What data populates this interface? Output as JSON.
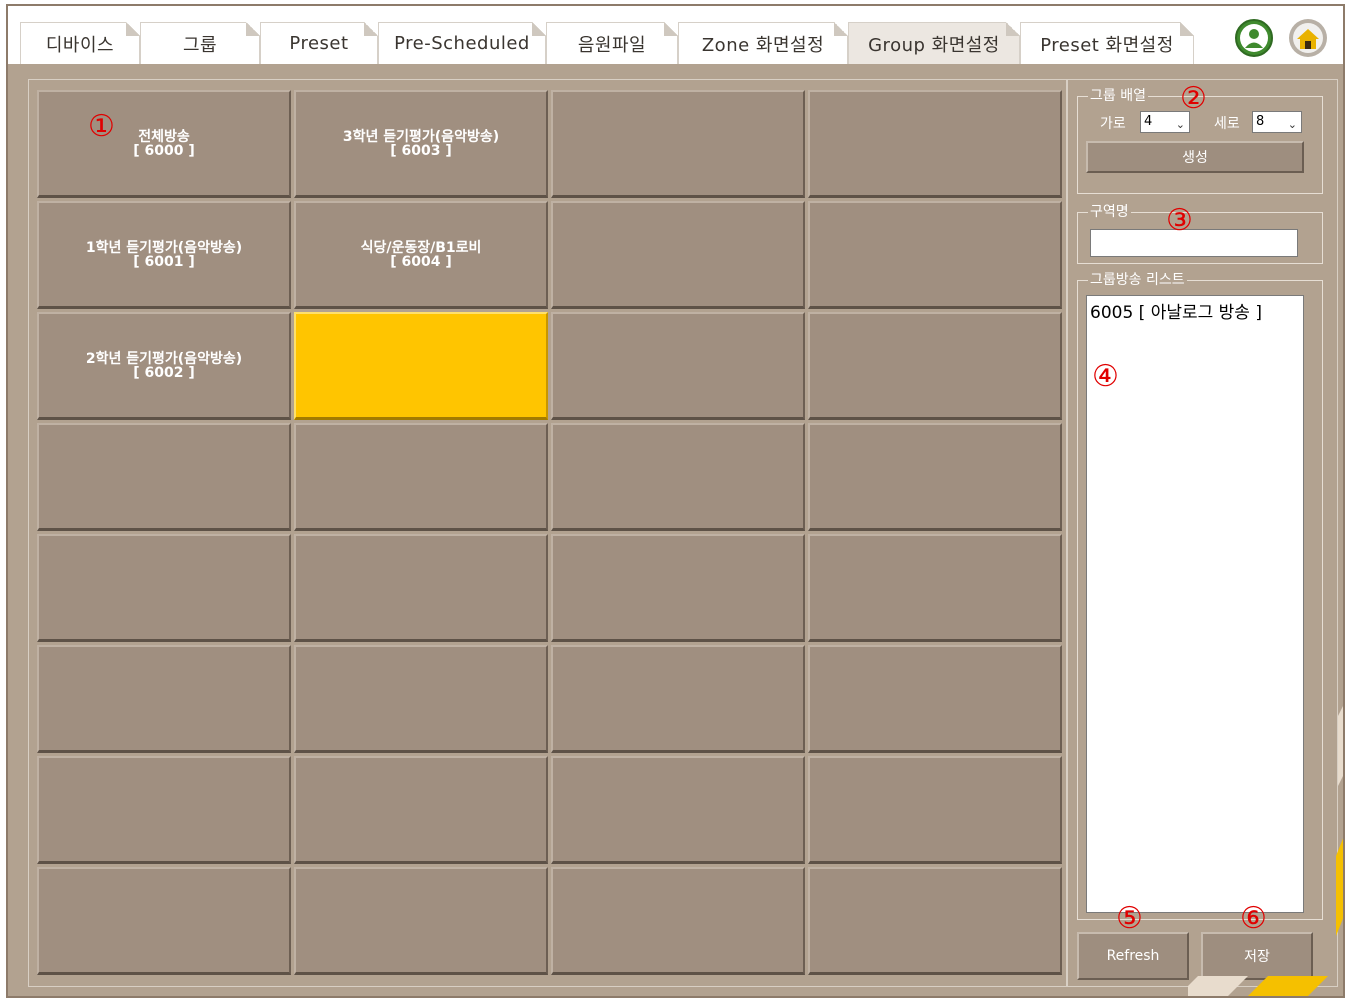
{
  "tabs": [
    {
      "label": "디바이스",
      "active": false
    },
    {
      "label": "그룹",
      "active": false
    },
    {
      "label": "Preset",
      "active": false
    },
    {
      "label": "Pre-Scheduled",
      "active": false
    },
    {
      "label": "음원파일",
      "active": false
    },
    {
      "label": "Zone 화면설정",
      "active": false
    },
    {
      "label": "Group 화면설정",
      "active": true
    },
    {
      "label": "Preset 화면설정",
      "active": false
    }
  ],
  "top_icons": [
    {
      "icon": "user-icon",
      "color": "#3f8a2e"
    },
    {
      "icon": "home-icon",
      "color": "#e9b200"
    }
  ],
  "grid": {
    "cols": 4,
    "rows": 8,
    "cells": [
      {
        "name": "전체방송",
        "id": "[ 6000 ]"
      },
      {
        "name": "3학년 듣기평가(음악방송)",
        "id": "[ 6003 ]"
      },
      {
        "name": "",
        "id": ""
      },
      {
        "name": "",
        "id": ""
      },
      {
        "name": "1학년 듣기평가(음악방송)",
        "id": "[ 6001 ]"
      },
      {
        "name": "식당/운동장/B1로비",
        "id": "[ 6004 ]"
      },
      {
        "name": "",
        "id": ""
      },
      {
        "name": "",
        "id": ""
      },
      {
        "name": "2학년 듣기평가(음악방송)",
        "id": "[ 6002 ]"
      },
      {
        "name": "",
        "id": "",
        "selected": true
      },
      {
        "name": "",
        "id": ""
      },
      {
        "name": "",
        "id": ""
      }
    ]
  },
  "side": {
    "layout_legend": "그룹 배열",
    "cols_label": "가로",
    "cols_value": "4",
    "rows_label": "세로",
    "rows_value": "8",
    "create_button": "생성",
    "zone_name_legend": "구역명",
    "zone_name_value": "",
    "group_list_legend": "그룹방송 리스트",
    "group_list_items": [
      "6005 [ 아날로그 방송 ]"
    ],
    "refresh_button": "Refresh",
    "save_button": "저장"
  },
  "annotations": [
    "①",
    "②",
    "③",
    "④",
    "⑤",
    "⑥"
  ],
  "colors": {
    "panel_bg": "#b2a290",
    "cell_bg": "#a08f80",
    "cell_selected": "#ffc500",
    "annotation": "#e00000"
  }
}
